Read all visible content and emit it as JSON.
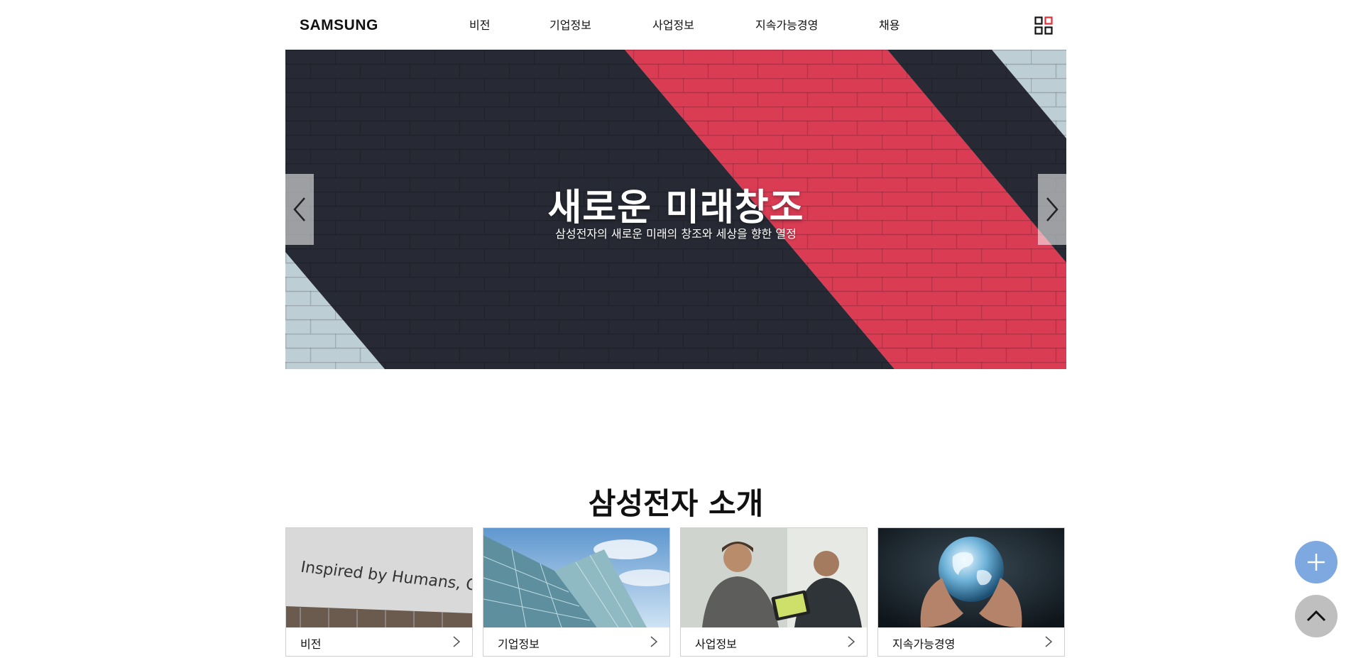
{
  "header": {
    "logo": "SAMSUNG",
    "nav": [
      {
        "label": "비전"
      },
      {
        "label": "기업정보"
      },
      {
        "label": "사업정보"
      },
      {
        "label": "지속가능경영"
      },
      {
        "label": "채용"
      }
    ],
    "menu_icon": "grid-menu-icon"
  },
  "hero": {
    "title": "새로운 미래창조",
    "subtitle": "삼성전자의 새로운 미래의 창조와 세상을 향한 열정",
    "image_text": "",
    "colors": {
      "stripe_dark": "#2a2d38",
      "stripe_red": "#e8405a",
      "stripe_light": "#c9dbe3"
    }
  },
  "section": {
    "title": "삼성전자 소개",
    "cards": [
      {
        "label": "비전",
        "image_caption": "Inspired by Humans, Creating the Future"
      },
      {
        "label": "기업정보"
      },
      {
        "label": "사업정보"
      },
      {
        "label": "지속가능경영"
      }
    ]
  },
  "floating": {
    "plus_icon": "plus-icon",
    "top_icon": "chevron-up-icon",
    "colors": {
      "plus": "#7ea8e0",
      "top": "#bfbfbf"
    }
  }
}
